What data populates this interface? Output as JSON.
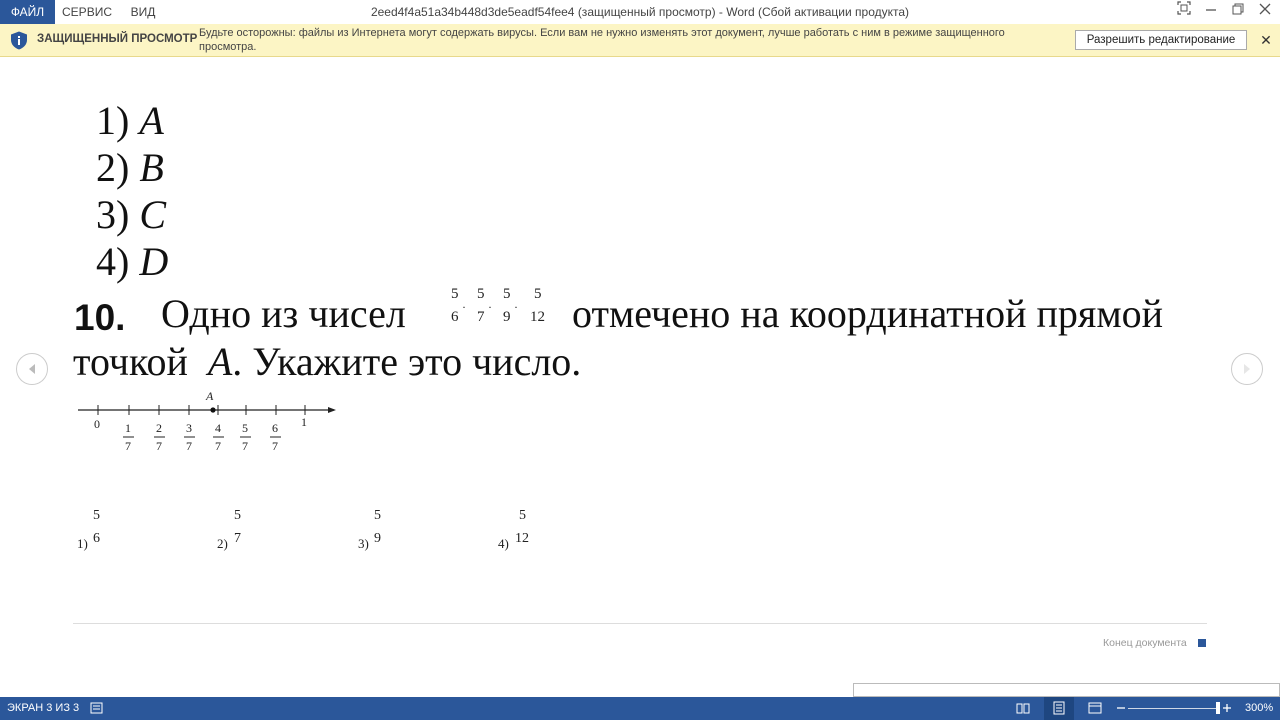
{
  "titlebar": {
    "menu": [
      "ФАЙЛ",
      "СЕРВИС",
      "ВИД"
    ],
    "title": "2eed4f4a51a34b448d3de5eadf54fee4 (защищенный просмотр) - Word (Сбой активации продукта)"
  },
  "message_bar": {
    "title": "ЗАЩИЩЕННЫЙ ПРОСМОТР",
    "text": "Будьте осторожны: файлы из Интернета могут содержать вирусы. Если вам не нужно изменять этот документ, лучше работать с ним в режиме защищенного просмотра.",
    "enable_button": "Разрешить редактирование",
    "close": "✕"
  },
  "document": {
    "prev_options": [
      {
        "num": "1)",
        "letter": "A"
      },
      {
        "num": "2)",
        "letter": "B"
      },
      {
        "num": "3)",
        "letter": "C"
      },
      {
        "num": "4)",
        "letter": "D"
      }
    ],
    "question_number": "10.",
    "question_part1": "Одно из чисел",
    "question_part2": "отмечено на координатной прямой",
    "question_part3a": "точкой",
    "question_point": "A",
    "question_part3b": ". Укажите это число.",
    "inline_fractions": [
      {
        "num": "5",
        "den": "6"
      },
      {
        "num": "5",
        "den": "7"
      },
      {
        "num": "5",
        "den": "9"
      },
      {
        "num": "5",
        "den": "12"
      }
    ],
    "number_line": {
      "point_label": "A",
      "zero": "0",
      "one": "1",
      "fractions": [
        {
          "num": "1",
          "den": "7"
        },
        {
          "num": "2",
          "den": "7"
        },
        {
          "num": "3",
          "den": "7"
        },
        {
          "num": "4",
          "den": "7"
        },
        {
          "num": "5",
          "den": "7"
        },
        {
          "num": "6",
          "den": "7"
        }
      ]
    },
    "answers": [
      {
        "label": "1)",
        "num": "5",
        "den": "6"
      },
      {
        "label": "2)",
        "num": "5",
        "den": "7"
      },
      {
        "label": "3)",
        "num": "5",
        "den": "9"
      },
      {
        "label": "4)",
        "num": "5",
        "den": "12"
      }
    ],
    "end_of_document": "Конец документа"
  },
  "statusbar": {
    "screen": "ЭКРАН 3 ИЗ 3",
    "zoom": "300%"
  }
}
